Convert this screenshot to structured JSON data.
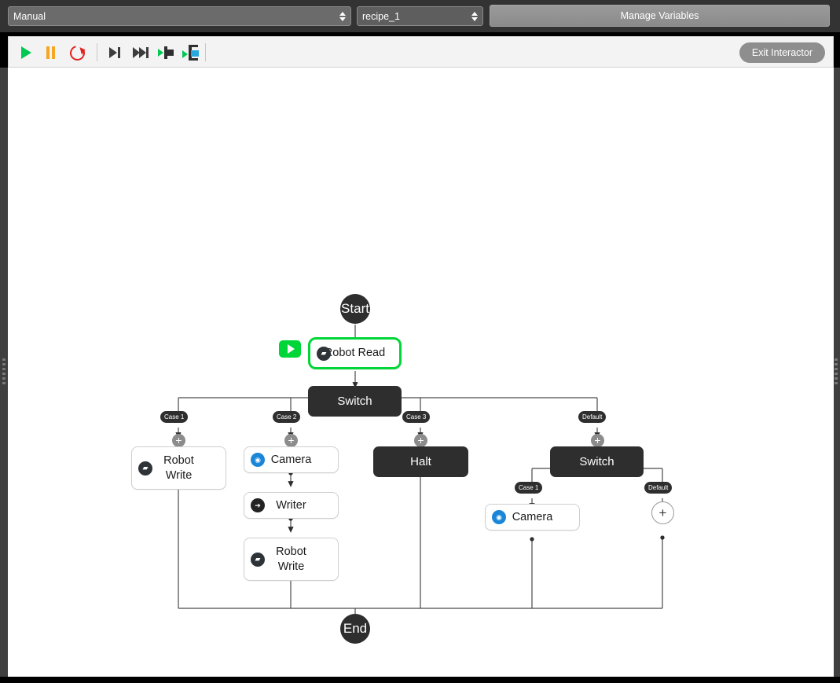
{
  "topbar": {
    "mode_select": {
      "value": "Manual",
      "name": "mode-select"
    },
    "recipe_select": {
      "value": "recipe_1",
      "name": "recipe-select"
    },
    "manage_variables_label": "Manage Variables"
  },
  "toolbar": {
    "buttons": [
      {
        "name": "play-button",
        "icon": "play-icon",
        "title": "Play"
      },
      {
        "name": "pause-button",
        "icon": "pause-icon",
        "title": "Pause"
      },
      {
        "name": "reset-button",
        "icon": "reset-icon",
        "title": "Reset"
      },
      {
        "name": "step-into-button",
        "icon": "step-into-icon",
        "title": "Step Into"
      },
      {
        "name": "step-over-button",
        "icon": "step-over-icon",
        "title": "Step Over"
      },
      {
        "name": "run-to-node-button",
        "icon": "run-to-node-icon",
        "title": "Run To Node"
      },
      {
        "name": "run-to-breakpoint-button",
        "icon": "run-to-breakpoint-icon",
        "title": "Run To Breakpoint"
      }
    ],
    "exit_label": "Exit Interactor"
  },
  "graph": {
    "start_label": "Start",
    "end_label": "End",
    "nodes": {
      "robot_read": "Robot Read",
      "switch_main": "Switch",
      "robot_write_1": "Robot\nWrite",
      "camera_1": "Camera",
      "writer_1": "Writer",
      "robot_write_2": "Robot\nWrite",
      "halt": "Halt",
      "switch_nested": "Switch",
      "camera_2": "Camera"
    },
    "node_lines": {
      "robot_write_1_a": "Robot",
      "robot_write_1_b": "Write",
      "robot_write_2_a": "Robot",
      "robot_write_2_b": "Write"
    },
    "branch_tags": {
      "main_case_1": "Case 1",
      "main_case_2": "Case 2",
      "main_case_3": "Case 3",
      "main_default": "Default",
      "nested_case_1": "Case 1",
      "nested_default": "Default"
    },
    "add_symbol": "+",
    "icons": {
      "robot": "robot-icon",
      "camera": "camera-icon",
      "writer": "writer-icon"
    }
  },
  "colors": {
    "accent_green": "#00d637",
    "dark_node": "#2e2e2e",
    "camera_blue": "#1a86d8",
    "chrome": "#333333",
    "canvas": "#ffffff"
  }
}
